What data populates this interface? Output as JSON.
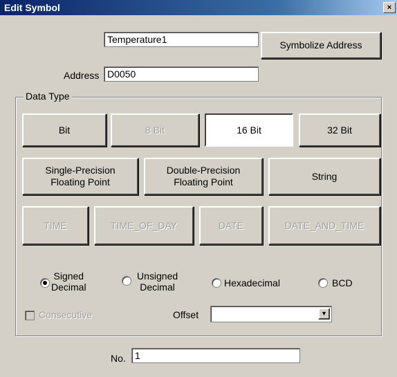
{
  "window": {
    "title": "Edit Symbol",
    "close_glyph": "×"
  },
  "symbol_name": {
    "value": "Temperature1"
  },
  "symbolize_button": "Symbolize Address",
  "address": {
    "label": "Address",
    "value": "D0050"
  },
  "data_type": {
    "label": "Data Type",
    "row1": [
      {
        "label": "Bit",
        "state": "normal"
      },
      {
        "label": "8 Bit",
        "state": "disabled"
      },
      {
        "label": "16 Bit",
        "state": "selected"
      },
      {
        "label": "32 Bit",
        "state": "normal"
      }
    ],
    "row2": [
      {
        "line1": "Single-Precision",
        "line2": "Floating Point",
        "state": "normal"
      },
      {
        "line1": "Double-Precision",
        "line2": "Floating Point",
        "state": "normal"
      },
      {
        "line1": "String",
        "line2": "",
        "state": "normal"
      }
    ],
    "row3": [
      {
        "label": "TIME",
        "state": "disabled"
      },
      {
        "label": "TIME_OF_DAY",
        "state": "disabled"
      },
      {
        "label": "DATE",
        "state": "disabled"
      },
      {
        "label": "DATE_AND_TIME",
        "state": "disabled"
      }
    ]
  },
  "format": {
    "options": [
      {
        "line1": "Signed",
        "line2": "Decimal",
        "checked": true
      },
      {
        "line1": "Unsigned",
        "line2": "Decimal",
        "checked": false
      },
      {
        "line1": "Hexadecimal",
        "line2": "",
        "checked": false
      },
      {
        "line1": "BCD",
        "line2": "",
        "checked": false
      }
    ]
  },
  "consecutive": {
    "label": "Consecutive",
    "checked": false,
    "enabled": false
  },
  "offset": {
    "label": "Offset",
    "value": ""
  },
  "number": {
    "label": "No.",
    "value": "1"
  }
}
